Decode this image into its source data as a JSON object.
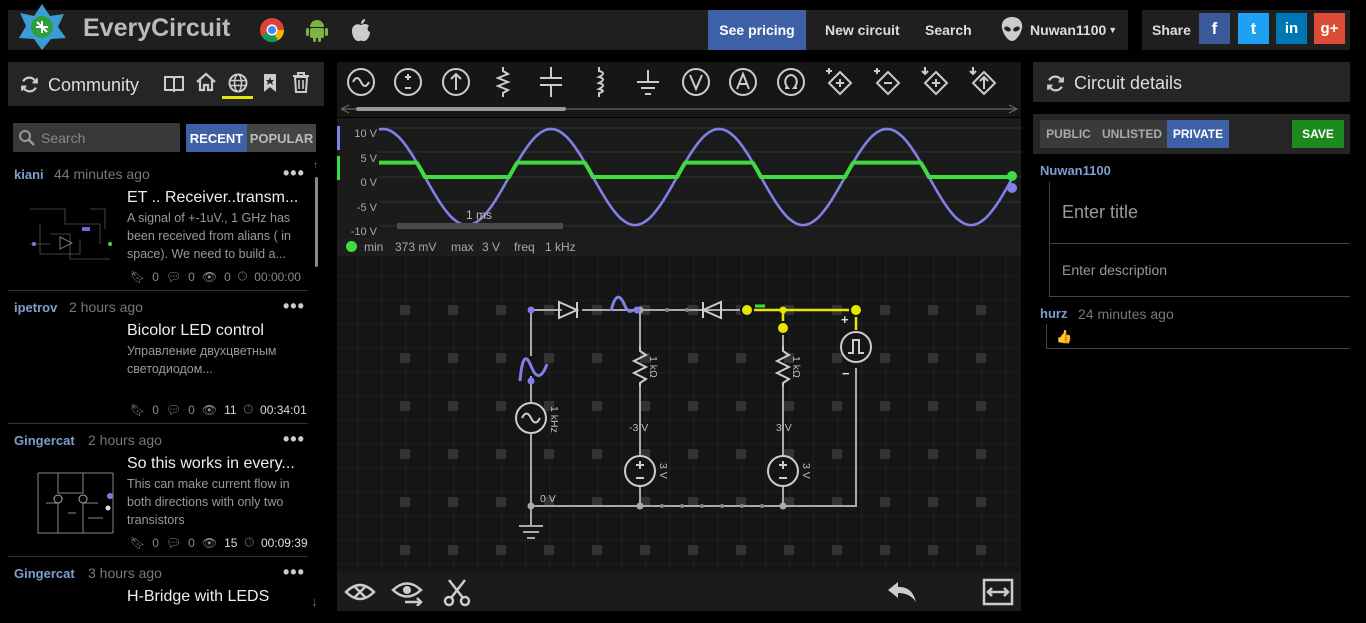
{
  "app": {
    "name": "EveryCircuit"
  },
  "nav": {
    "pricing": "See pricing",
    "new_circuit": "New circuit",
    "search": "Search",
    "user": "Nuwan1100",
    "share": "Share"
  },
  "social": {
    "facebook": "f",
    "twitter": "t",
    "linkedin": "in",
    "google": "g+"
  },
  "community": {
    "title": "Community",
    "search_placeholder": "Search",
    "tab_recent": "RECENT",
    "tab_popular": "POPULAR",
    "items": [
      {
        "user": "kiani",
        "time": "44 minutes ago",
        "title": "ET .. Receiver..transm...",
        "desc": "A signal of +-1uV., 1 GHz has been received from alians ( in space). We need to build a...",
        "bookmarks": "0",
        "comments": "0",
        "views": "0",
        "duration": "00:00:00"
      },
      {
        "user": "ipetrov",
        "time": "2 hours ago",
        "title": "Bicolor LED control",
        "desc": "Управление двухцветным светодиодом...",
        "bookmarks": "0",
        "comments": "0",
        "views": "11",
        "duration": "00:34:01"
      },
      {
        "user": "Gingercat",
        "time": "2 hours ago",
        "title": "So this works in every...",
        "desc": "This can make current flow in both directions with only two transistors",
        "bookmarks": "0",
        "comments": "0",
        "views": "15",
        "duration": "00:09:39"
      },
      {
        "user": "Gingercat",
        "time": "3 hours ago",
        "title": "H-Bridge with LEDS",
        "desc": "",
        "bookmarks": "",
        "comments": "",
        "views": "",
        "duration": ""
      }
    ]
  },
  "scope": {
    "y_labels": [
      "10 V",
      "5 V",
      "0 V",
      "-5 V",
      "-10 V"
    ],
    "time_label": "1 ms",
    "min_label": "min",
    "min_value": "373 mV",
    "max_label": "max",
    "max_value": "3 V",
    "freq_label": "freq",
    "freq_value": "1 kHz"
  },
  "circuit": {
    "labels": {
      "r1": "1 kΩ",
      "r2": "1 kΩ",
      "src": "1 kHz",
      "v1": "3 V",
      "v2": "3 V",
      "node_left": "-3 V",
      "node_right": "3 V",
      "ground": "0 V",
      "plus": "+",
      "minus": "−"
    }
  },
  "details": {
    "title": "Circuit details",
    "public": "PUBLIC",
    "unlisted": "UNLISTED",
    "private": "PRIVATE",
    "save": "SAVE",
    "owner": "Nuwan1100",
    "title_placeholder": "Enter title",
    "desc_placeholder": "Enter description",
    "comment_user": "hurz",
    "comment_time": "24 minutes ago",
    "comment_text": "👍"
  },
  "colors": {
    "accent": "#3d60a6",
    "save": "#1c8a1c",
    "trace_green": "#3fdc3f",
    "trace_purple": "#8080e6",
    "yellow": "#e6e600"
  }
}
